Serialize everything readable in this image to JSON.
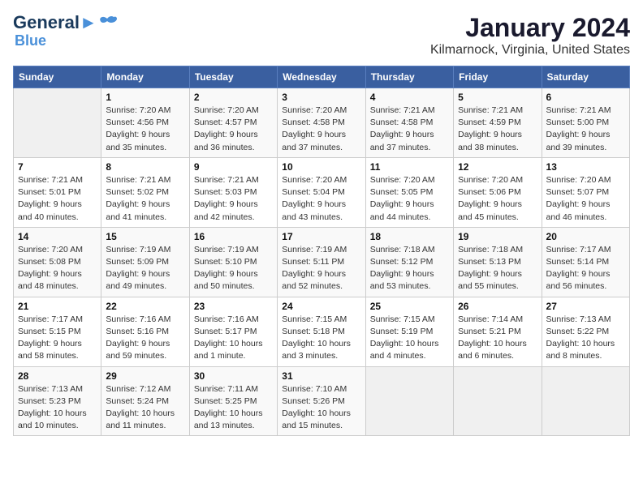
{
  "header": {
    "logo_line1": "General",
    "logo_line2": "Blue",
    "title": "January 2024",
    "subtitle": "Kilmarnock, Virginia, United States"
  },
  "days_of_week": [
    "Sunday",
    "Monday",
    "Tuesday",
    "Wednesday",
    "Thursday",
    "Friday",
    "Saturday"
  ],
  "weeks": [
    [
      {
        "num": "",
        "info": ""
      },
      {
        "num": "1",
        "info": "Sunrise: 7:20 AM\nSunset: 4:56 PM\nDaylight: 9 hours\nand 35 minutes."
      },
      {
        "num": "2",
        "info": "Sunrise: 7:20 AM\nSunset: 4:57 PM\nDaylight: 9 hours\nand 36 minutes."
      },
      {
        "num": "3",
        "info": "Sunrise: 7:20 AM\nSunset: 4:58 PM\nDaylight: 9 hours\nand 37 minutes."
      },
      {
        "num": "4",
        "info": "Sunrise: 7:21 AM\nSunset: 4:58 PM\nDaylight: 9 hours\nand 37 minutes."
      },
      {
        "num": "5",
        "info": "Sunrise: 7:21 AM\nSunset: 4:59 PM\nDaylight: 9 hours\nand 38 minutes."
      },
      {
        "num": "6",
        "info": "Sunrise: 7:21 AM\nSunset: 5:00 PM\nDaylight: 9 hours\nand 39 minutes."
      }
    ],
    [
      {
        "num": "7",
        "info": "Sunrise: 7:21 AM\nSunset: 5:01 PM\nDaylight: 9 hours\nand 40 minutes."
      },
      {
        "num": "8",
        "info": "Sunrise: 7:21 AM\nSunset: 5:02 PM\nDaylight: 9 hours\nand 41 minutes."
      },
      {
        "num": "9",
        "info": "Sunrise: 7:21 AM\nSunset: 5:03 PM\nDaylight: 9 hours\nand 42 minutes."
      },
      {
        "num": "10",
        "info": "Sunrise: 7:20 AM\nSunset: 5:04 PM\nDaylight: 9 hours\nand 43 minutes."
      },
      {
        "num": "11",
        "info": "Sunrise: 7:20 AM\nSunset: 5:05 PM\nDaylight: 9 hours\nand 44 minutes."
      },
      {
        "num": "12",
        "info": "Sunrise: 7:20 AM\nSunset: 5:06 PM\nDaylight: 9 hours\nand 45 minutes."
      },
      {
        "num": "13",
        "info": "Sunrise: 7:20 AM\nSunset: 5:07 PM\nDaylight: 9 hours\nand 46 minutes."
      }
    ],
    [
      {
        "num": "14",
        "info": "Sunrise: 7:20 AM\nSunset: 5:08 PM\nDaylight: 9 hours\nand 48 minutes."
      },
      {
        "num": "15",
        "info": "Sunrise: 7:19 AM\nSunset: 5:09 PM\nDaylight: 9 hours\nand 49 minutes."
      },
      {
        "num": "16",
        "info": "Sunrise: 7:19 AM\nSunset: 5:10 PM\nDaylight: 9 hours\nand 50 minutes."
      },
      {
        "num": "17",
        "info": "Sunrise: 7:19 AM\nSunset: 5:11 PM\nDaylight: 9 hours\nand 52 minutes."
      },
      {
        "num": "18",
        "info": "Sunrise: 7:18 AM\nSunset: 5:12 PM\nDaylight: 9 hours\nand 53 minutes."
      },
      {
        "num": "19",
        "info": "Sunrise: 7:18 AM\nSunset: 5:13 PM\nDaylight: 9 hours\nand 55 minutes."
      },
      {
        "num": "20",
        "info": "Sunrise: 7:17 AM\nSunset: 5:14 PM\nDaylight: 9 hours\nand 56 minutes."
      }
    ],
    [
      {
        "num": "21",
        "info": "Sunrise: 7:17 AM\nSunset: 5:15 PM\nDaylight: 9 hours\nand 58 minutes."
      },
      {
        "num": "22",
        "info": "Sunrise: 7:16 AM\nSunset: 5:16 PM\nDaylight: 9 hours\nand 59 minutes."
      },
      {
        "num": "23",
        "info": "Sunrise: 7:16 AM\nSunset: 5:17 PM\nDaylight: 10 hours\nand 1 minute."
      },
      {
        "num": "24",
        "info": "Sunrise: 7:15 AM\nSunset: 5:18 PM\nDaylight: 10 hours\nand 3 minutes."
      },
      {
        "num": "25",
        "info": "Sunrise: 7:15 AM\nSunset: 5:19 PM\nDaylight: 10 hours\nand 4 minutes."
      },
      {
        "num": "26",
        "info": "Sunrise: 7:14 AM\nSunset: 5:21 PM\nDaylight: 10 hours\nand 6 minutes."
      },
      {
        "num": "27",
        "info": "Sunrise: 7:13 AM\nSunset: 5:22 PM\nDaylight: 10 hours\nand 8 minutes."
      }
    ],
    [
      {
        "num": "28",
        "info": "Sunrise: 7:13 AM\nSunset: 5:23 PM\nDaylight: 10 hours\nand 10 minutes."
      },
      {
        "num": "29",
        "info": "Sunrise: 7:12 AM\nSunset: 5:24 PM\nDaylight: 10 hours\nand 11 minutes."
      },
      {
        "num": "30",
        "info": "Sunrise: 7:11 AM\nSunset: 5:25 PM\nDaylight: 10 hours\nand 13 minutes."
      },
      {
        "num": "31",
        "info": "Sunrise: 7:10 AM\nSunset: 5:26 PM\nDaylight: 10 hours\nand 15 minutes."
      },
      {
        "num": "",
        "info": ""
      },
      {
        "num": "",
        "info": ""
      },
      {
        "num": "",
        "info": ""
      }
    ]
  ]
}
